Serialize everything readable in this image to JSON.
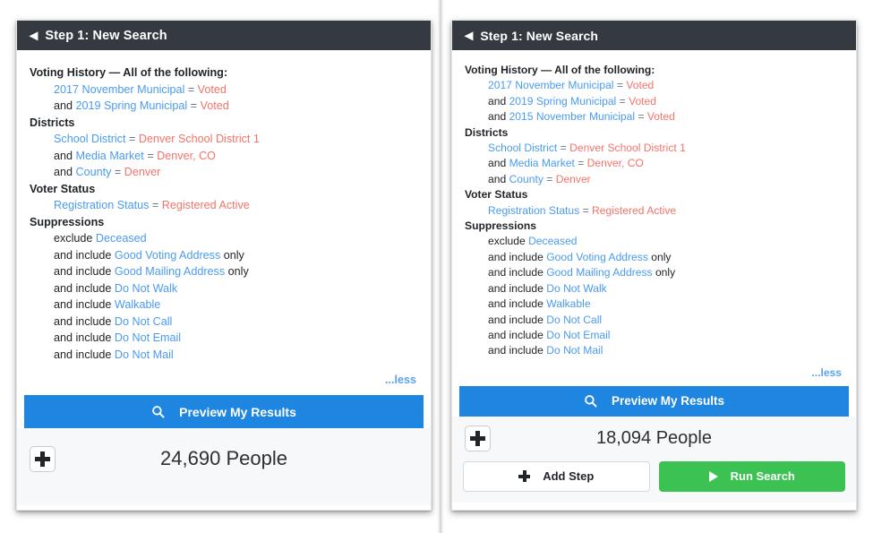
{
  "colors": {
    "header_bg": "#343a40",
    "field_blue": "#4a9bf0",
    "value_red": "#f4736a",
    "primary_blue": "#1e86e0",
    "success_green": "#3cc153",
    "text_dark": "#212529"
  },
  "panels": [
    {
      "id": "left",
      "header": {
        "title": "Step 1: New Search",
        "back_icon": "back-caret-icon"
      },
      "groups": [
        {
          "title": "Voting History — All of the following:",
          "lines": [
            {
              "conj": "",
              "field": "2017 November Municipal",
              "op": "=",
              "value": "Voted",
              "suffix": ""
            },
            {
              "conj": "and",
              "field": "2019 Spring Municipal",
              "op": "=",
              "value": "Voted",
              "suffix": ""
            }
          ]
        },
        {
          "title": "Districts",
          "lines": [
            {
              "conj": "",
              "field": "School District",
              "op": "=",
              "value": "Denver School District 1",
              "suffix": ""
            },
            {
              "conj": "and",
              "field": "Media Market",
              "op": "=",
              "value": "Denver, CO",
              "suffix": ""
            },
            {
              "conj": "and",
              "field": "County",
              "op": "=",
              "value": "Denver",
              "suffix": ""
            }
          ]
        },
        {
          "title": "Voter Status",
          "lines": [
            {
              "conj": "",
              "field": "Registration Status",
              "op": "=",
              "value": "Registered Active",
              "suffix": ""
            }
          ]
        },
        {
          "title": "Suppressions",
          "lines": [
            {
              "conj": "exclude",
              "field": "Deceased",
              "op": "",
              "value": "",
              "suffix": ""
            },
            {
              "conj": "and include",
              "field": "Good Voting Address",
              "op": "",
              "value": "",
              "suffix": "only"
            },
            {
              "conj": "and include",
              "field": "Good Mailing Address",
              "op": "",
              "value": "",
              "suffix": "only"
            },
            {
              "conj": "and include",
              "field": "Do Not Walk",
              "op": "",
              "value": "",
              "suffix": ""
            },
            {
              "conj": "and include",
              "field": "Walkable",
              "op": "",
              "value": "",
              "suffix": ""
            },
            {
              "conj": "and include",
              "field": "Do Not Call",
              "op": "",
              "value": "",
              "suffix": ""
            },
            {
              "conj": "and include",
              "field": "Do Not Email",
              "op": "",
              "value": "",
              "suffix": ""
            },
            {
              "conj": "and include",
              "field": "Do Not Mail",
              "op": "",
              "value": "",
              "suffix": ""
            }
          ]
        }
      ],
      "less_label": "...less",
      "preview_label": "Preview My Results",
      "preview_icon": "search-icon",
      "add_icon": "plus-icon",
      "count_label": "24,690 People",
      "footer_actions": []
    },
    {
      "id": "right",
      "header": {
        "title": "Step 1: New Search",
        "back_icon": "back-caret-icon"
      },
      "groups": [
        {
          "title": "Voting History — All of the following:",
          "lines": [
            {
              "conj": "",
              "field": "2017 November Municipal",
              "op": "=",
              "value": "Voted",
              "suffix": ""
            },
            {
              "conj": "and",
              "field": "2019 Spring Municipal",
              "op": "=",
              "value": "Voted",
              "suffix": ""
            },
            {
              "conj": "and",
              "field": "2015 November Municipal",
              "op": "=",
              "value": "Voted",
              "suffix": ""
            }
          ]
        },
        {
          "title": "Districts",
          "lines": [
            {
              "conj": "",
              "field": "School District",
              "op": "=",
              "value": "Denver School District 1",
              "suffix": ""
            },
            {
              "conj": "and",
              "field": "Media Market",
              "op": "=",
              "value": "Denver, CO",
              "suffix": ""
            },
            {
              "conj": "and",
              "field": "County",
              "op": "=",
              "value": "Denver",
              "suffix": ""
            }
          ]
        },
        {
          "title": "Voter Status",
          "lines": [
            {
              "conj": "",
              "field": "Registration Status",
              "op": "=",
              "value": "Registered Active",
              "suffix": ""
            }
          ]
        },
        {
          "title": "Suppressions",
          "lines": [
            {
              "conj": "exclude",
              "field": "Deceased",
              "op": "",
              "value": "",
              "suffix": ""
            },
            {
              "conj": "and include",
              "field": "Good Voting Address",
              "op": "",
              "value": "",
              "suffix": "only"
            },
            {
              "conj": "and include",
              "field": "Good Mailing Address",
              "op": "",
              "value": "",
              "suffix": "only"
            },
            {
              "conj": "and include",
              "field": "Do Not Walk",
              "op": "",
              "value": "",
              "suffix": ""
            },
            {
              "conj": "and include",
              "field": "Walkable",
              "op": "",
              "value": "",
              "suffix": ""
            },
            {
              "conj": "and include",
              "field": "Do Not Call",
              "op": "",
              "value": "",
              "suffix": ""
            },
            {
              "conj": "and include",
              "field": "Do Not Email",
              "op": "",
              "value": "",
              "suffix": ""
            },
            {
              "conj": "and include",
              "field": "Do Not Mail",
              "op": "",
              "value": "",
              "suffix": ""
            }
          ]
        }
      ],
      "less_label": "...less",
      "preview_label": "Preview My Results",
      "preview_icon": "search-icon",
      "add_icon": "plus-icon",
      "count_label": "18,094 People",
      "footer_actions": [
        {
          "label": "Add Step",
          "icon": "plus-icon",
          "style": "secondary"
        },
        {
          "label": "Run Search",
          "icon": "play-icon",
          "style": "success"
        }
      ]
    }
  ]
}
